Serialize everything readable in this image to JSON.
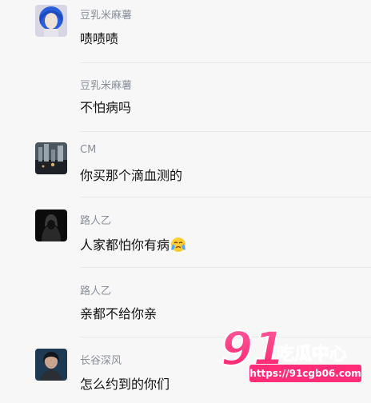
{
  "comments": [
    {
      "name": "豆乳米麻薯",
      "text": "啧啧啧",
      "has_avatar": true
    },
    {
      "name": "豆乳米麻薯",
      "text": "不怕病吗",
      "has_avatar": false
    },
    {
      "name": "CM",
      "text": "你买那个滴血测的",
      "has_avatar": true
    },
    {
      "name": "路人乙",
      "text": "人家都怕你有病",
      "has_avatar": true,
      "emoji": "crying-face"
    },
    {
      "name": "路人乙",
      "text": "亲都不给你亲",
      "has_avatar": false
    },
    {
      "name": "长谷深风",
      "text": "怎么约到的你们",
      "has_avatar": true
    }
  ],
  "watermark": {
    "logo": "91吃瓜中心",
    "url": "https://91cgb06.com"
  },
  "colors": {
    "background": "#f7f7f7",
    "username": "#8a8f99",
    "text": "#111111",
    "watermark_pink": "#ff2d78"
  }
}
